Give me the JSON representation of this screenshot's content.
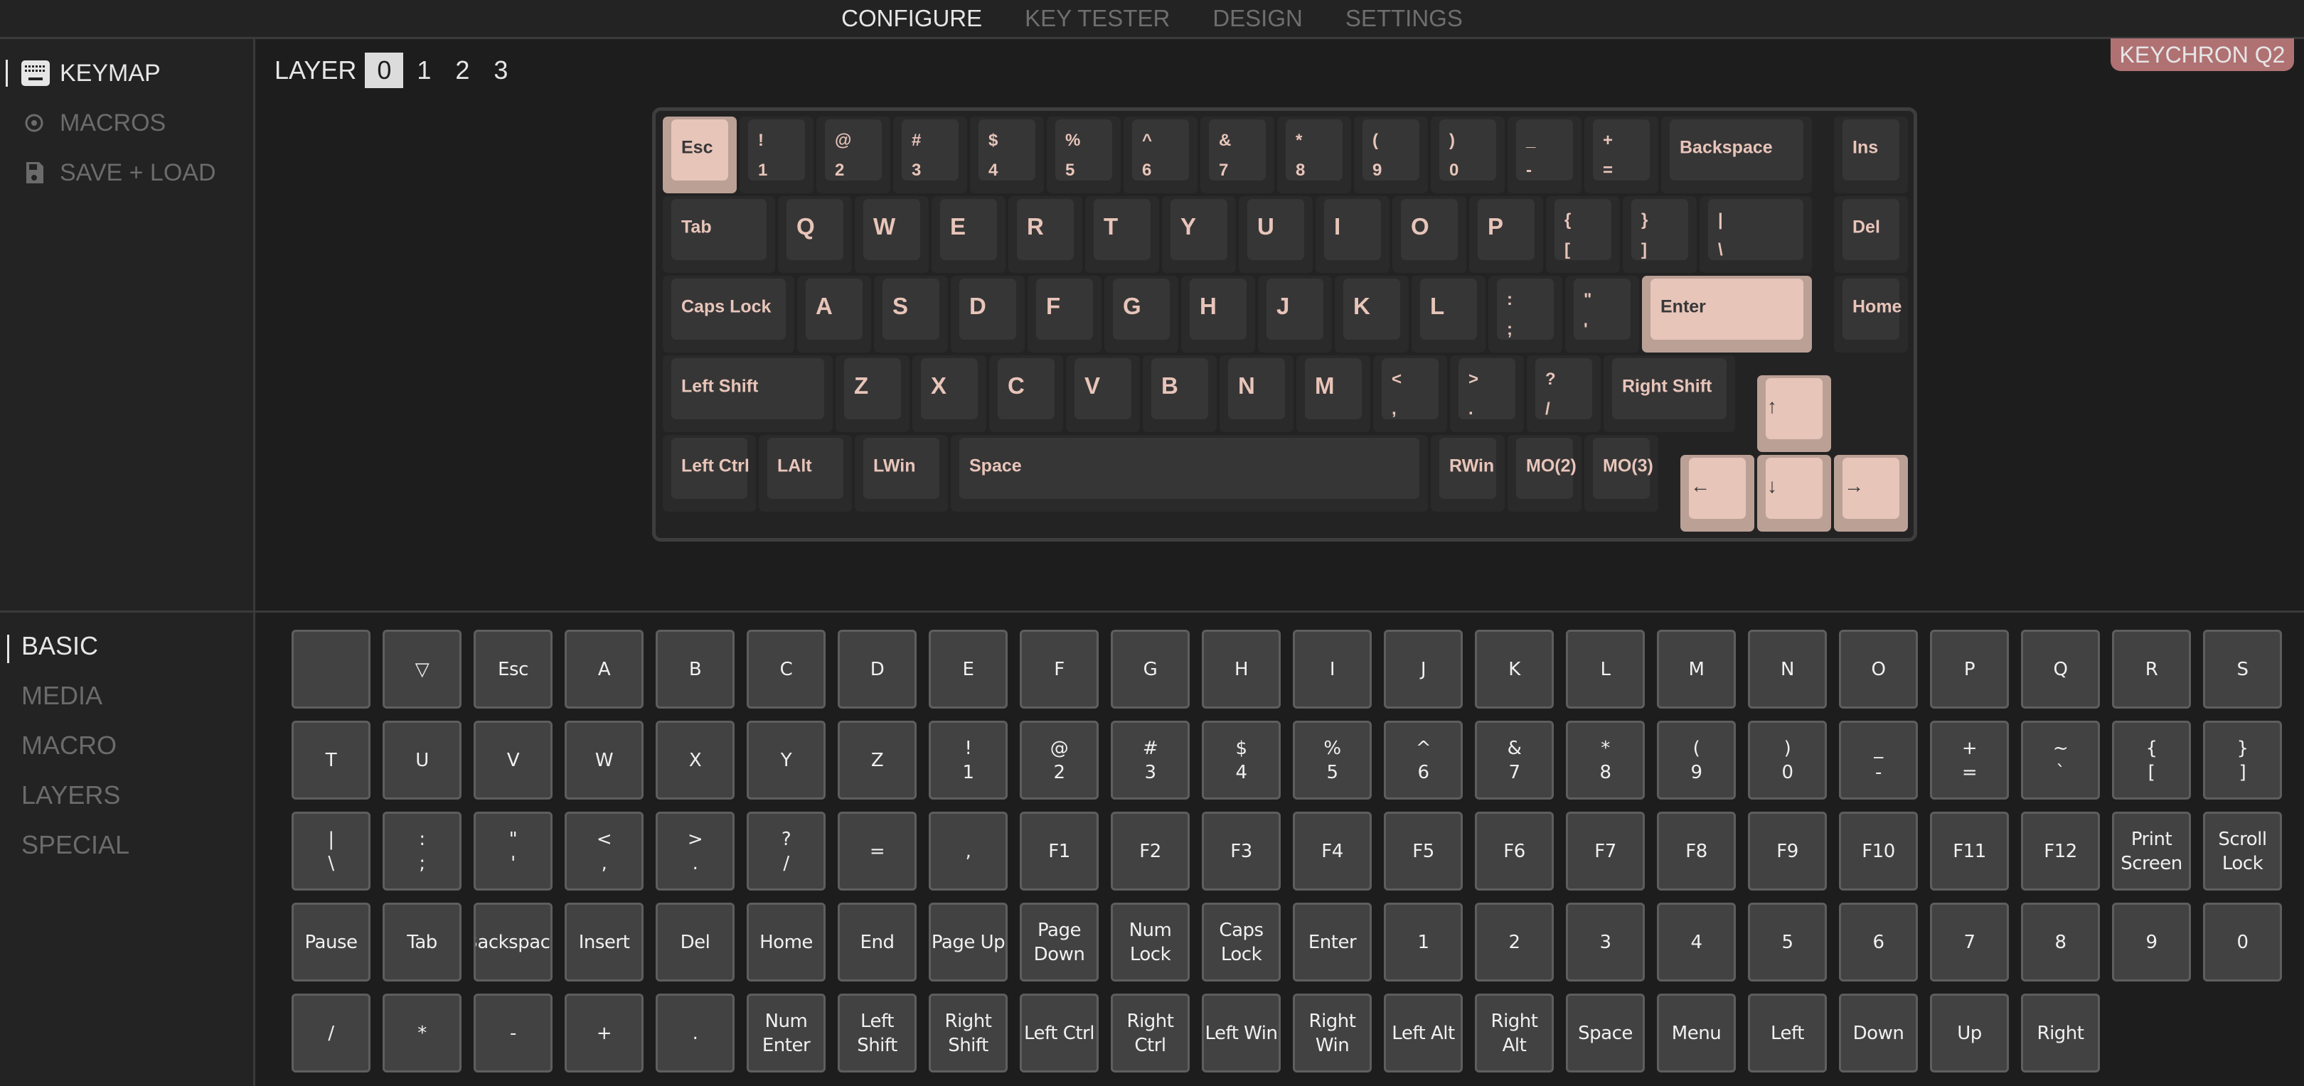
{
  "topnav": {
    "items": [
      "CONFIGURE",
      "KEY TESTER",
      "DESIGN",
      "SETTINGS"
    ],
    "active": 0
  },
  "sidebar": {
    "items": [
      {
        "label": "KEYMAP",
        "icon": "keyboard-icon",
        "active": true
      },
      {
        "label": "MACROS",
        "icon": "target-icon",
        "active": false
      },
      {
        "label": "SAVE + LOAD",
        "icon": "save-icon",
        "active": false
      }
    ]
  },
  "layer": {
    "label": "LAYER",
    "options": [
      "0",
      "1",
      "2",
      "3"
    ],
    "active": "0"
  },
  "device": {
    "name": "KEYCHRON Q2"
  },
  "colors": {
    "accent_keycap": "#e8c5b9",
    "legend": "#e8c5b9",
    "badge": "#b07173"
  },
  "keyboard": {
    "keys": [
      {
        "row": 0,
        "col": 0,
        "w": 1,
        "top": "Esc",
        "accent": true
      },
      {
        "row": 0,
        "col": 1,
        "w": 1,
        "top": "!",
        "bottom": "1"
      },
      {
        "row": 0,
        "col": 2,
        "w": 1,
        "top": "@",
        "bottom": "2"
      },
      {
        "row": 0,
        "col": 3,
        "w": 1,
        "top": "#",
        "bottom": "3"
      },
      {
        "row": 0,
        "col": 4,
        "w": 1,
        "top": "$",
        "bottom": "4"
      },
      {
        "row": 0,
        "col": 5,
        "w": 1,
        "top": "%",
        "bottom": "5"
      },
      {
        "row": 0,
        "col": 6,
        "w": 1,
        "top": "^",
        "bottom": "6"
      },
      {
        "row": 0,
        "col": 7,
        "w": 1,
        "top": "&",
        "bottom": "7"
      },
      {
        "row": 0,
        "col": 8,
        "w": 1,
        "top": "*",
        "bottom": "8"
      },
      {
        "row": 0,
        "col": 9,
        "w": 1,
        "top": "(",
        "bottom": "9"
      },
      {
        "row": 0,
        "col": 10,
        "w": 1,
        "top": ")",
        "bottom": "0"
      },
      {
        "row": 0,
        "col": 11,
        "w": 1,
        "top": "_",
        "bottom": "-"
      },
      {
        "row": 0,
        "col": 12,
        "w": 1,
        "top": "+",
        "bottom": "="
      },
      {
        "row": 0,
        "col": 13,
        "w": 2,
        "top": "Backspace"
      },
      {
        "row": 0,
        "col": 15.25,
        "w": 1,
        "top": "Ins"
      },
      {
        "row": 1,
        "col": 0,
        "w": 1.5,
        "top": "Tab"
      },
      {
        "row": 1,
        "col": 1.5,
        "w": 1,
        "top": "Q",
        "letter": true
      },
      {
        "row": 1,
        "col": 2.5,
        "w": 1,
        "top": "W",
        "letter": true
      },
      {
        "row": 1,
        "col": 3.5,
        "w": 1,
        "top": "E",
        "letter": true
      },
      {
        "row": 1,
        "col": 4.5,
        "w": 1,
        "top": "R",
        "letter": true
      },
      {
        "row": 1,
        "col": 5.5,
        "w": 1,
        "top": "T",
        "letter": true
      },
      {
        "row": 1,
        "col": 6.5,
        "w": 1,
        "top": "Y",
        "letter": true
      },
      {
        "row": 1,
        "col": 7.5,
        "w": 1,
        "top": "U",
        "letter": true
      },
      {
        "row": 1,
        "col": 8.5,
        "w": 1,
        "top": "I",
        "letter": true
      },
      {
        "row": 1,
        "col": 9.5,
        "w": 1,
        "top": "O",
        "letter": true
      },
      {
        "row": 1,
        "col": 10.5,
        "w": 1,
        "top": "P",
        "letter": true
      },
      {
        "row": 1,
        "col": 11.5,
        "w": 1,
        "top": "{",
        "bottom": "["
      },
      {
        "row": 1,
        "col": 12.5,
        "w": 1,
        "top": "}",
        "bottom": "]"
      },
      {
        "row": 1,
        "col": 13.5,
        "w": 1.5,
        "top": "|",
        "bottom": "\\"
      },
      {
        "row": 1,
        "col": 15.25,
        "w": 1,
        "top": "Del"
      },
      {
        "row": 2,
        "col": 0,
        "w": 1.75,
        "top": "Caps Lock"
      },
      {
        "row": 2,
        "col": 1.75,
        "w": 1,
        "top": "A",
        "letter": true
      },
      {
        "row": 2,
        "col": 2.75,
        "w": 1,
        "top": "S",
        "letter": true
      },
      {
        "row": 2,
        "col": 3.75,
        "w": 1,
        "top": "D",
        "letter": true
      },
      {
        "row": 2,
        "col": 4.75,
        "w": 1,
        "top": "F",
        "letter": true
      },
      {
        "row": 2,
        "col": 5.75,
        "w": 1,
        "top": "G",
        "letter": true
      },
      {
        "row": 2,
        "col": 6.75,
        "w": 1,
        "top": "H",
        "letter": true
      },
      {
        "row": 2,
        "col": 7.75,
        "w": 1,
        "top": "J",
        "letter": true
      },
      {
        "row": 2,
        "col": 8.75,
        "w": 1,
        "top": "K",
        "letter": true
      },
      {
        "row": 2,
        "col": 9.75,
        "w": 1,
        "top": "L",
        "letter": true
      },
      {
        "row": 2,
        "col": 10.75,
        "w": 1,
        "top": ":",
        "bottom": ";"
      },
      {
        "row": 2,
        "col": 11.75,
        "w": 1,
        "top": "\"",
        "bottom": "'"
      },
      {
        "row": 2,
        "col": 12.75,
        "w": 2.25,
        "top": "Enter",
        "accent": true
      },
      {
        "row": 2,
        "col": 15.25,
        "w": 1,
        "top": "Home"
      },
      {
        "row": 3,
        "col": 0,
        "w": 2.25,
        "top": "Left Shift"
      },
      {
        "row": 3,
        "col": 2.25,
        "w": 1,
        "top": "Z",
        "letter": true
      },
      {
        "row": 3,
        "col": 3.25,
        "w": 1,
        "top": "X",
        "letter": true
      },
      {
        "row": 3,
        "col": 4.25,
        "w": 1,
        "top": "C",
        "letter": true
      },
      {
        "row": 3,
        "col": 5.25,
        "w": 1,
        "top": "V",
        "letter": true
      },
      {
        "row": 3,
        "col": 6.25,
        "w": 1,
        "top": "B",
        "letter": true
      },
      {
        "row": 3,
        "col": 7.25,
        "w": 1,
        "top": "N",
        "letter": true
      },
      {
        "row": 3,
        "col": 8.25,
        "w": 1,
        "top": "M",
        "letter": true
      },
      {
        "row": 3,
        "col": 9.25,
        "w": 1,
        "top": "<",
        "bottom": ","
      },
      {
        "row": 3,
        "col": 10.25,
        "w": 1,
        "top": ">",
        "bottom": "."
      },
      {
        "row": 3,
        "col": 11.25,
        "w": 1,
        "top": "?",
        "bottom": "/"
      },
      {
        "row": 3,
        "col": 12.25,
        "w": 1.75,
        "top": "Right Shift"
      },
      {
        "row": 3.25,
        "col": 14.25,
        "w": 1,
        "top": "↑",
        "accent": true
      },
      {
        "row": 4,
        "col": 0,
        "w": 1.25,
        "top": "Left Ctrl"
      },
      {
        "row": 4,
        "col": 1.25,
        "w": 1.25,
        "top": "LAlt"
      },
      {
        "row": 4,
        "col": 2.5,
        "w": 1.25,
        "top": "LWin"
      },
      {
        "row": 4,
        "col": 3.75,
        "w": 6.25,
        "top": "Space"
      },
      {
        "row": 4,
        "col": 10,
        "w": 1,
        "top": "RWin"
      },
      {
        "row": 4,
        "col": 11,
        "w": 1,
        "top": "MO(2)"
      },
      {
        "row": 4,
        "col": 12,
        "w": 1,
        "top": "MO(3)"
      },
      {
        "row": 4.25,
        "col": 13.25,
        "w": 1,
        "top": "←",
        "accent": true
      },
      {
        "row": 4.25,
        "col": 14.25,
        "w": 1,
        "top": "↓",
        "accent": true
      },
      {
        "row": 4.25,
        "col": 15.25,
        "w": 1,
        "top": "→",
        "accent": true
      }
    ]
  },
  "categories": {
    "items": [
      "BASIC",
      "MEDIA",
      "MACRO",
      "LAYERS",
      "SPECIAL"
    ],
    "active": 0
  },
  "palette": {
    "rows": [
      [
        "",
        "▽",
        "Esc",
        "A",
        "B",
        "C",
        "D",
        "E",
        "F",
        "G",
        "H",
        "I",
        "J",
        "K",
        "L",
        "M",
        "N",
        "O",
        "P",
        "Q",
        "R",
        "S"
      ],
      [
        "T",
        "U",
        "V",
        "W",
        "X",
        "Y",
        "Z",
        "!\n1",
        "@\n2",
        "#\n3",
        "$\n4",
        "%\n5",
        "^\n6",
        "&\n7",
        "*\n8",
        "(\n9",
        ")\n0",
        "_\n-",
        "+\n=",
        "~\n`",
        "{\n[",
        "}\n]"
      ],
      [
        "|\n\\",
        ":\n;",
        "\"\n'",
        "<\n,",
        ">\n.",
        "?\n/",
        "=",
        ",",
        "F1",
        "F2",
        "F3",
        "F4",
        "F5",
        "F6",
        "F7",
        "F8",
        "F9",
        "F10",
        "F11",
        "F12",
        "Print\nScreen",
        "Scroll\nLock"
      ],
      [
        "Pause",
        "Tab",
        "Backspace",
        "Insert",
        "Del",
        "Home",
        "End",
        "Page Up",
        "Page\nDown",
        "Num\nLock",
        "Caps\nLock",
        "Enter",
        "1",
        "2",
        "3",
        "4",
        "5",
        "6",
        "7",
        "8",
        "9",
        "0"
      ],
      [
        "/",
        "*",
        "-",
        "+",
        ".",
        "Num\nEnter",
        "Left\nShift",
        "Right\nShift",
        "Left Ctrl",
        "Right\nCtrl",
        "Left Win",
        "Right\nWin",
        "Left Alt",
        "Right Alt",
        "Space",
        "Menu",
        "Left",
        "Down",
        "Up",
        "Right"
      ]
    ]
  }
}
